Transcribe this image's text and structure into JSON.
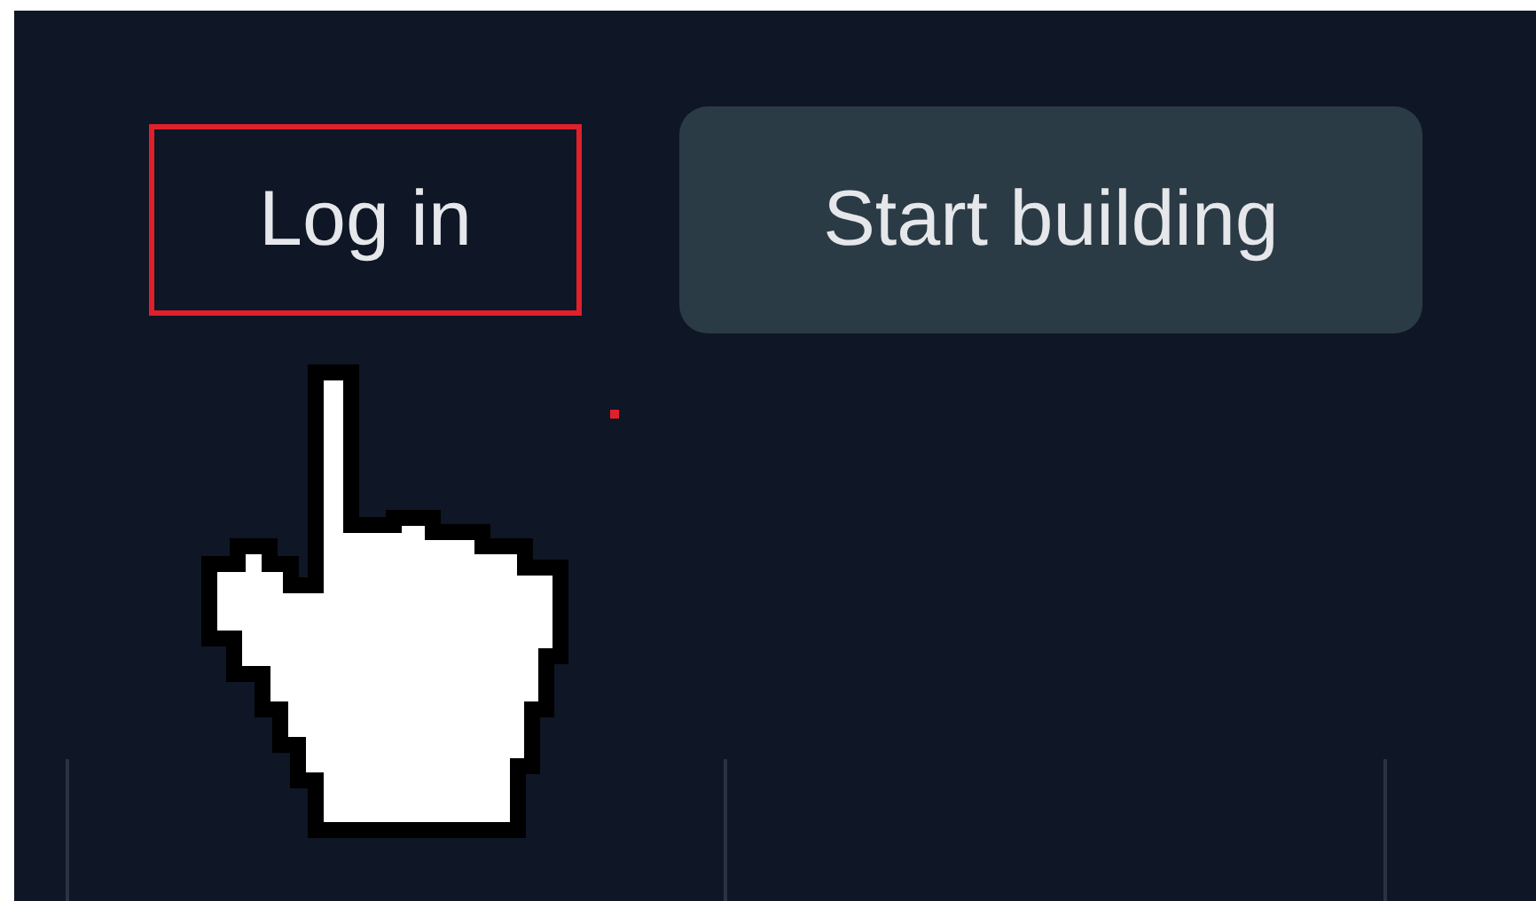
{
  "nav": {
    "login": {
      "label": "Log in",
      "highlighted": true
    },
    "cta": {
      "label": "Start building"
    }
  }
}
